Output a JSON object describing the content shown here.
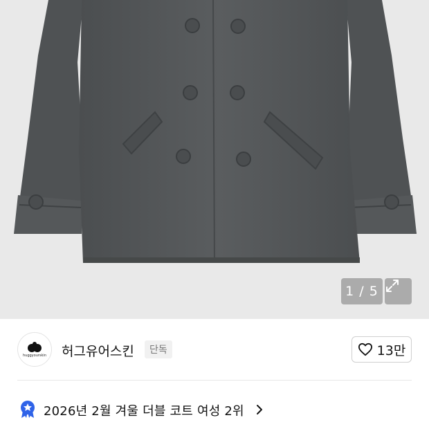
{
  "gallery": {
    "counter": "1 / 5",
    "expand_icon": "expand-arrows-icon",
    "background": "#e9e9e9",
    "coat_color": "#555859"
  },
  "store": {
    "name": "허그유어스킨",
    "badge": "단독",
    "logo_icon": "store-logo-icon",
    "logo_tiny_text": "huggyourskin"
  },
  "like": {
    "icon": "heart-icon",
    "count": "13만"
  },
  "ranking": {
    "icon": "star-badge-icon",
    "text": "2026년 2월 겨울 더블 코트 여성 2위",
    "chevron": "chevron-right-icon",
    "accent": "#2f63e8"
  }
}
